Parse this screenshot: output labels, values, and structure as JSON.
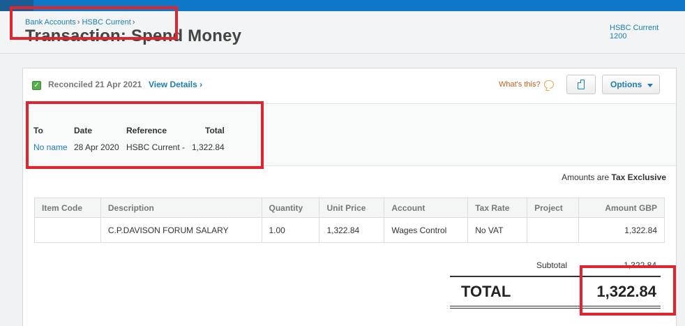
{
  "breadcrumb": {
    "item1": "Bank Accounts",
    "item2": "HSBC Current",
    "sep": "›"
  },
  "page": {
    "title": "Transaction: Spend Money"
  },
  "account": {
    "name": "HSBC Current",
    "code": "1200"
  },
  "status": {
    "reconciled": "Reconciled 21 Apr 2021",
    "view_details": "View Details ›"
  },
  "help": {
    "whats_this": "What's this?"
  },
  "toolbar": {
    "options_label": "Options"
  },
  "summary": {
    "to_label": "To",
    "to_value": "No name",
    "date_label": "Date",
    "date_value": "28 Apr 2020",
    "reference_label": "Reference",
    "reference_value": "HSBC Current -",
    "total_label": "Total",
    "total_value": "1,322.84"
  },
  "tax_note": {
    "prefix": "Amounts are",
    "mode": "Tax Exclusive"
  },
  "table": {
    "headers": [
      "Item Code",
      "Description",
      "Quantity",
      "Unit Price",
      "Account",
      "Tax Rate",
      "Project",
      "Amount GBP"
    ],
    "rows": [
      [
        "",
        "C.P.DAVISON FORUM SALARY",
        "1.00",
        "1,322.84",
        "Wages Control",
        "No VAT",
        "",
        "1,322.84"
      ]
    ]
  },
  "totals": {
    "subtotal_label": "Subtotal",
    "subtotal_value": "1,322.84",
    "total_label": "TOTAL",
    "total_value": "1,322.84"
  },
  "colors": {
    "brand": "#0f77c8",
    "link": "#1a7db5",
    "highlight": "#e1252f",
    "reconciled_check": "#54b04a"
  }
}
